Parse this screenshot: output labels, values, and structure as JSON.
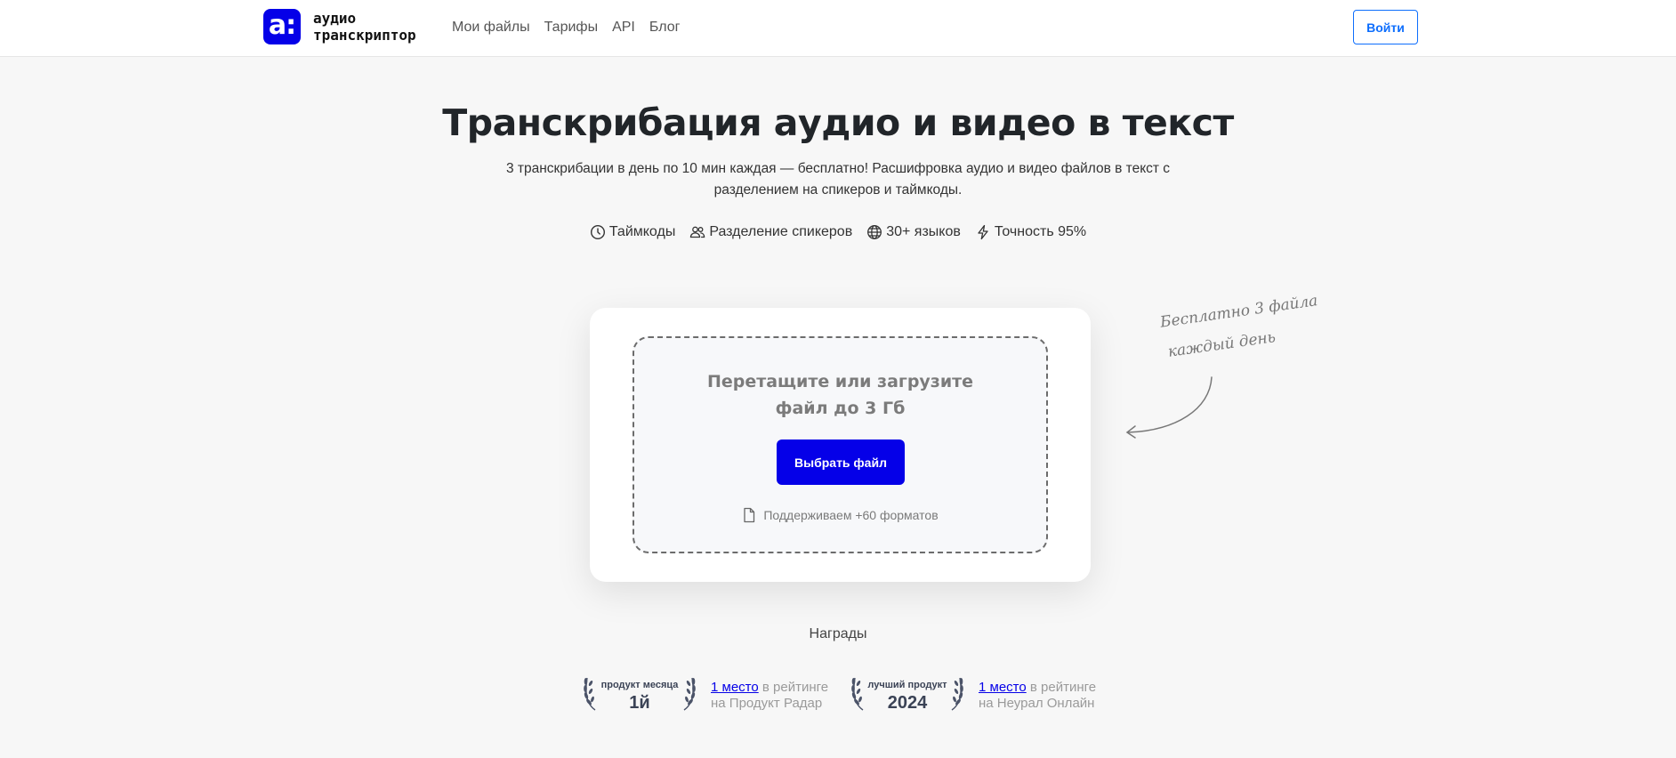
{
  "header": {
    "logo_mark": "a:",
    "logo_line1": "аудио",
    "logo_line2": "транскриптор",
    "nav": [
      "Мои файлы",
      "Тарифы",
      "API",
      "Блог"
    ],
    "login_label": "Войти"
  },
  "hero": {
    "title": "Транскрибация аудио и видео в текст",
    "subtitle": "3 транскрибации в день по 10 мин каждая — бесплатно! Расшифровка аудио и видео файлов в текст с разделением на спикеров и таймкоды.",
    "features": [
      {
        "icon": "clock-icon",
        "label": "Таймкоды"
      },
      {
        "icon": "users-icon",
        "label": "Разделение спикеров"
      },
      {
        "icon": "globe-icon",
        "label": "30+ языков"
      },
      {
        "icon": "lightning-icon",
        "label": "Точность 95%"
      }
    ]
  },
  "upload": {
    "title_line1": "Перетащите или загрузите",
    "title_line2": "файл до 3 Гб",
    "button_label": "Выбрать файл",
    "formats_label": "Поддерживаем +60 форматов"
  },
  "note": {
    "line1": "Бесплатно 3 файла",
    "line2": "каждый день"
  },
  "awards": {
    "title": "Награды",
    "items": [
      {
        "badge_top": "продукт месяца",
        "badge_main": "1й",
        "link": "1 место",
        "text_after": " в рейтинге",
        "text_line2": "на Продукт Радар"
      },
      {
        "badge_top": "лучший продукт",
        "badge_main": "2024",
        "link": "1 место",
        "text_after": " в рейтинге",
        "text_line2": "на Неурал Онлайн"
      }
    ]
  },
  "colors": {
    "brand": "#0500e8",
    "login_outline": "#0d6efd",
    "background": "#f7f7f7"
  }
}
